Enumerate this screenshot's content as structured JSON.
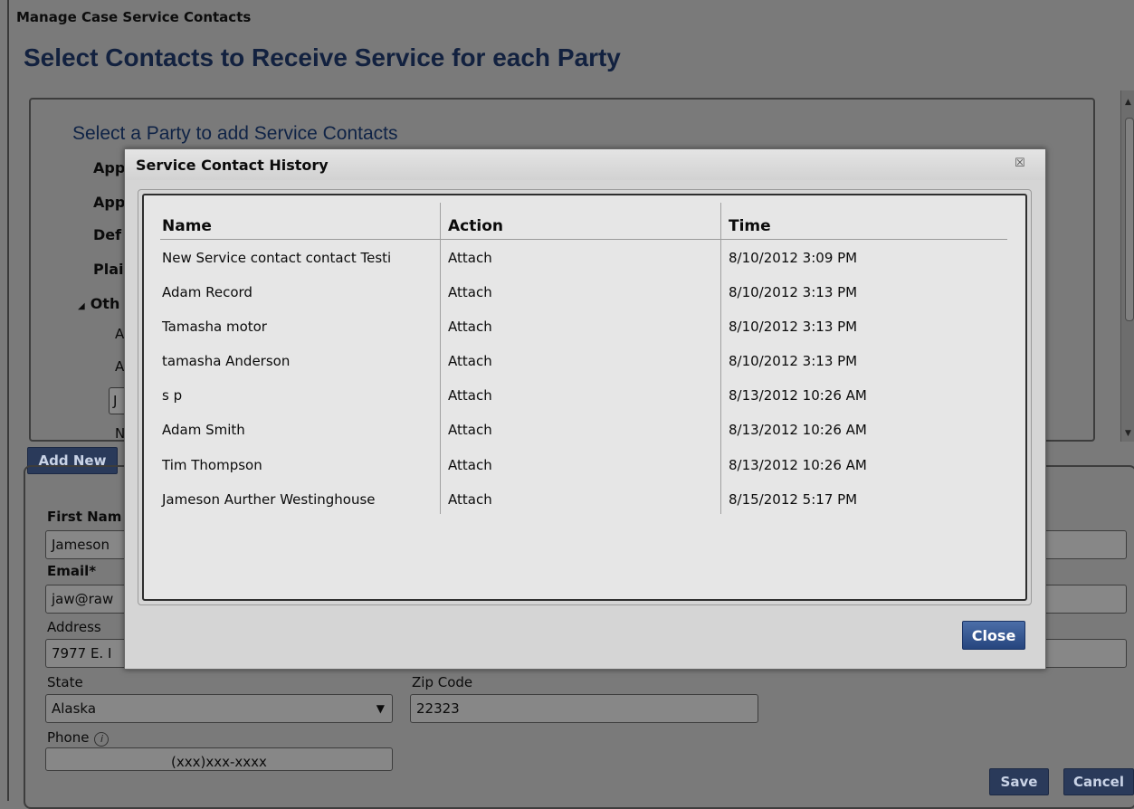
{
  "window": {
    "title": "Manage Case Service Contacts"
  },
  "page": {
    "heading": "Select Contacts to Receive Service for each Party"
  },
  "party_panel": {
    "heading": "Select a Party to add Service Contacts",
    "items": [
      "App",
      "App",
      "Def",
      "Plai",
      "Oth"
    ],
    "subitems": [
      "A",
      "A",
      "J",
      "N"
    ]
  },
  "buttons": {
    "add_new": "Add New",
    "save": "Save",
    "cancel": "Cancel"
  },
  "form": {
    "first_name_label": "First Nam",
    "first_name_value": "Jameson",
    "email_label": "Email*",
    "email_value": "jaw@raw",
    "address_label": "Address",
    "address_value": "7977 E. I",
    "state_label": "State",
    "state_value": "Alaska",
    "zip_label": "Zip Code",
    "zip_value": "22323",
    "phone_label": "Phone",
    "phone_placeholder": "(xxx)xxx-xxxx"
  },
  "modal": {
    "title": "Service Contact History",
    "close_x": "☒",
    "columns": [
      "Name",
      "Action",
      "Time"
    ],
    "rows": [
      {
        "name": "New Service contact contact Testi",
        "action": "Attach",
        "time": "8/10/2012 3:09 PM"
      },
      {
        "name": "Adam Record",
        "action": "Attach",
        "time": "8/10/2012 3:13 PM"
      },
      {
        "name": "Tamasha motor",
        "action": "Attach",
        "time": "8/10/2012 3:13 PM"
      },
      {
        "name": "tamasha Anderson",
        "action": "Attach",
        "time": "8/10/2012 3:13 PM"
      },
      {
        "name": "s p",
        "action": "Attach",
        "time": "8/13/2012 10:26 AM"
      },
      {
        "name": "Adam Smith",
        "action": "Attach",
        "time": "8/13/2012 10:26 AM"
      },
      {
        "name": "Tim Thompson",
        "action": "Attach",
        "time": "8/13/2012 10:26 AM"
      },
      {
        "name": "Jameson Aurther Westinghouse",
        "action": "Attach",
        "time": "8/15/2012 5:17 PM"
      }
    ],
    "close_label": "Close"
  },
  "colors": {
    "heading": "#12213f",
    "button_dark": "#2a3a5a",
    "close_button": "#26457e"
  },
  "icons": [
    "info-icon",
    "chevron-down-icon",
    "close-icon",
    "collapse-triangle-icon"
  ]
}
